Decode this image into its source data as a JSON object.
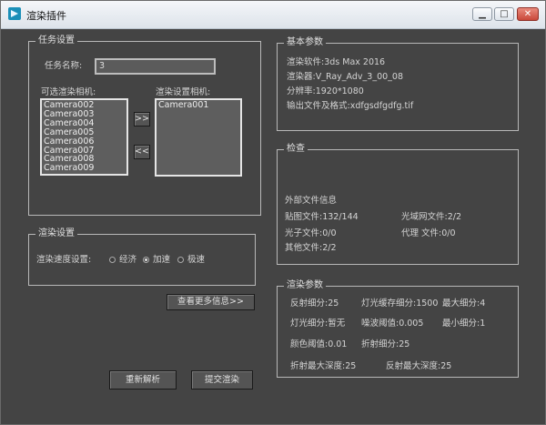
{
  "window": {
    "title": "渲染插件",
    "min": "▁",
    "max": "□",
    "close": "✕"
  },
  "task": {
    "legend": "任务设置",
    "name_label": "任务名称:",
    "name_value": "3",
    "available_label": "可选渲染相机:",
    "selected_label": "渲染设置相机:",
    "available_cameras": [
      "Camera002",
      "Camera003",
      "Camera004",
      "Camera005",
      "Camera006",
      "Camera007",
      "Camera008",
      "Camera009"
    ],
    "selected_cameras": [
      "Camera001"
    ],
    "add_button": ">>",
    "remove_button": "<<"
  },
  "render": {
    "legend": "渲染设置",
    "speed_label": "渲染速度设置:",
    "options": [
      "经济",
      "加速",
      "极速"
    ],
    "selected_index": 1
  },
  "more_button": "查看更多信息>>",
  "reparse_button": "重新解析",
  "submit_button": "提交渲染",
  "basic": {
    "legend": "基本参数",
    "lines": [
      "渲染软件:3ds Max 2016",
      "渲染器:V_Ray_Adv_3_00_08",
      "分辨率:1920*1080",
      "输出文件及格式:xdfgsdfgdfg.tif"
    ]
  },
  "check": {
    "legend": "检查",
    "ext_title": "外部文件信息",
    "maps": "贴图文件:132/144",
    "ies": "光域网文件:2/2",
    "photon": "光子文件:0/0",
    "proxy": "代理 文件:0/0",
    "other": "其他文件:2/2"
  },
  "params": {
    "legend": "渲染参数",
    "reflect_sub": "反射细分:25",
    "lightcache_sub": "灯光缓存细分:1500",
    "max_sub": "最大细分:4",
    "light_sub": "灯光细分:暂无",
    "noise": "噪波阈值:0.005",
    "min_sub": "最小细分:1",
    "color": "颜色阈值:0.01",
    "refract_sub": "折射细分:25",
    "refract_depth": "折射最大深度:25",
    "reflect_depth": "反射最大深度:25"
  }
}
